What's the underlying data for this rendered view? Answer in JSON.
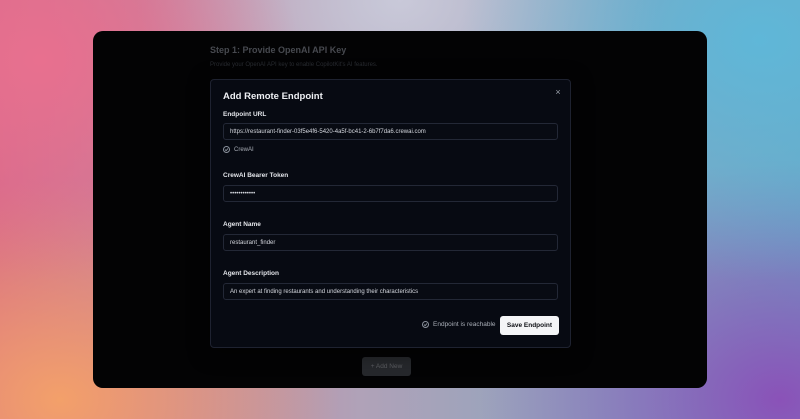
{
  "background_page": {
    "step_title": "Step 1: Provide OpenAI API Key",
    "step_description": "Provide your OpenAI API key to enable CopilotKit's AI features.",
    "add_new_label": "+ Add New"
  },
  "modal": {
    "title": "Add Remote Endpoint",
    "close_symbol": "×",
    "endpoint_url": {
      "label": "Endpoint URL",
      "value": "https://restaurant-finder-03f5e4f6-5420-4a5f-bc41-2-6b7f7da6.crewai.com",
      "detected_label": "CrewAI"
    },
    "bearer_token": {
      "label": "CrewAI Bearer Token",
      "value": "••••••••••••"
    },
    "agent_name": {
      "label": "Agent Name",
      "value": "restaurant_finder"
    },
    "agent_description": {
      "label": "Agent Description",
      "value": "An expert at finding restaurants and understanding their characteristics"
    },
    "status_text": "Endpoint is reachable",
    "save_label": "Save Endpoint"
  },
  "icons": {
    "close": "close-icon",
    "check": "check-circle-icon"
  },
  "colors": {
    "modal_background": "#070a12",
    "primary_button": "#f4f5f7",
    "window_background": "#050507"
  }
}
